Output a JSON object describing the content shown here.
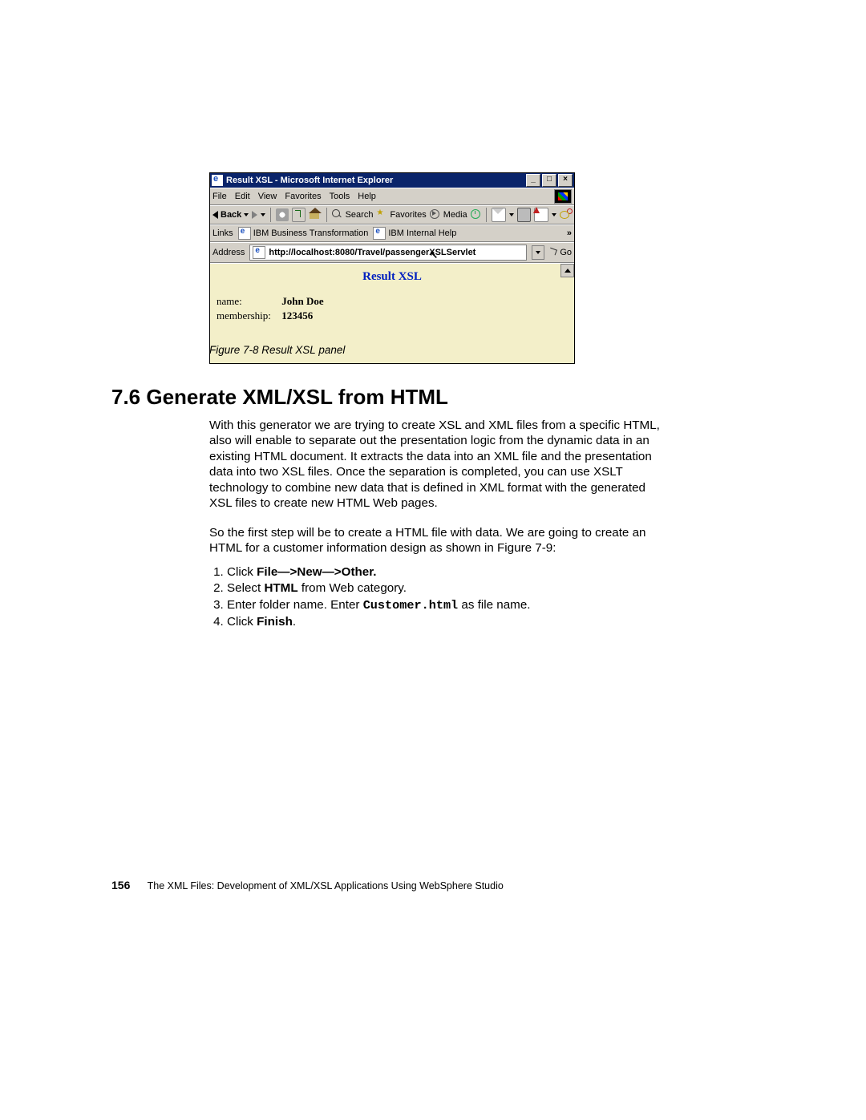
{
  "ie": {
    "title": "Result XSL - Microsoft Internet Explorer",
    "menu": {
      "file": "File",
      "edit": "Edit",
      "view": "View",
      "favorites": "Favorites",
      "tools": "Tools",
      "help": "Help"
    },
    "toolbar": {
      "back": "Back",
      "search": "Search",
      "favorites": "Favorites",
      "media": "Media"
    },
    "linksbar": {
      "label": "Links",
      "link1": "IBM Business Transformation",
      "link2": "IBM Internal Help",
      "expand": "»"
    },
    "addressbar": {
      "label": "Address",
      "url": "http://localhost:8080/Travel/passengerXSLServlet",
      "go": "Go"
    },
    "content": {
      "resultTitle": "Result XSL",
      "nameLabel": "name:",
      "nameValue": "John Doe",
      "membershipLabel": "membership:",
      "membershipValue": "123456"
    },
    "winbtns": {
      "min": "_",
      "max": "□",
      "close": "×"
    }
  },
  "caption": "Figure 7-8   Result XSL panel",
  "heading": "7.6  Generate XML/XSL from HTML",
  "para1": "With this generator we are trying to create XSL and XML files from a specific HTML, also will enable to separate out the presentation logic from the dynamic data in an existing HTML document. It extracts the data into an XML file and the presentation data into two XSL files. Once the separation is completed, you can use XSLT technology to combine new data that is defined in XML format with the generated XSL files to create new HTML Web pages.",
  "para2": "So the first step will be to create a HTML file with data. We are going to create an HTML for a customer information design as shown in Figure 7-9:",
  "steps": {
    "s1a": "Click ",
    "s1b": "File—>New—>Other.",
    "s2a": "Select ",
    "s2b": "HTML",
    "s2c": " from Web category.",
    "s3a": "Enter folder name. Enter ",
    "s3b": "Customer.html",
    "s3c": " as file name.",
    "s4a": "Click ",
    "s4b": "Finish",
    "s4c": "."
  },
  "footer": {
    "page": "156",
    "title": "The XML Files:  Development of XML/XSL Applications Using WebSphere Studio"
  }
}
